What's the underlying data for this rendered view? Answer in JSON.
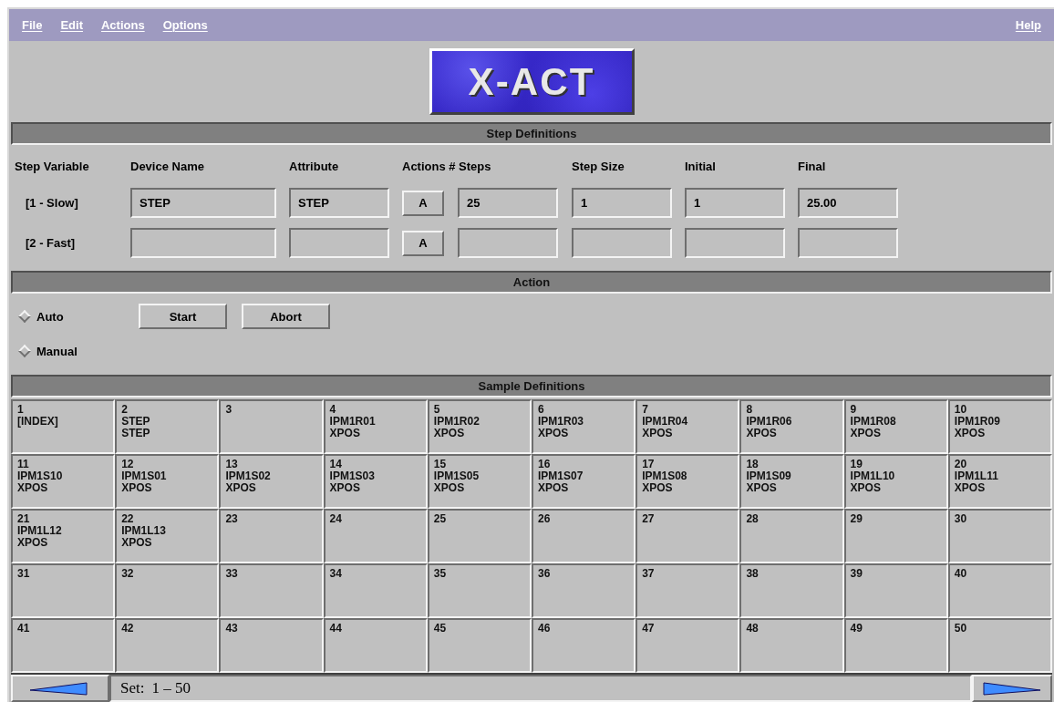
{
  "menu_bar": {
    "items": [
      "File",
      "Edit",
      "Actions",
      "Options"
    ],
    "help": "Help"
  },
  "logo": {
    "text": "X-ACT"
  },
  "step_definitions": {
    "title": "Step Definitions",
    "columns": [
      "Step Variable",
      "Device Name",
      "Attribute",
      "Actions # Steps",
      "Step Size",
      "Initial",
      "Final"
    ],
    "rows": [
      {
        "label": "[1 - Slow]",
        "device": "STEP",
        "attribute": "STEP",
        "action": "A",
        "steps": "25",
        "step_size": "1",
        "initial": "1",
        "final": "25.00"
      },
      {
        "label": "[2 - Fast]",
        "action": "A"
      }
    ]
  },
  "action": {
    "title": "Action",
    "modes": [
      {
        "label": "Auto",
        "selected": false
      },
      {
        "label": "Manual",
        "selected": false
      }
    ],
    "buttons": [
      "Start",
      "Abort"
    ]
  },
  "sample_definitions": {
    "title": "Sample Definitions",
    "cells": [
      {
        "number": "1",
        "lines": [
          "[INDEX]"
        ]
      },
      {
        "number": "2",
        "lines": [
          "STEP",
          "STEP"
        ]
      },
      {
        "number": "3"
      },
      {
        "number": "4",
        "lines": [
          "IPM1R01",
          "XPOS"
        ]
      },
      {
        "number": "5",
        "lines": [
          "IPM1R02",
          "XPOS"
        ]
      },
      {
        "number": "6",
        "lines": [
          "IPM1R03",
          "XPOS"
        ]
      },
      {
        "number": "7",
        "lines": [
          "IPM1R04",
          "XPOS"
        ]
      },
      {
        "number": "8",
        "lines": [
          "IPM1R06",
          "XPOS"
        ]
      },
      {
        "number": "9",
        "lines": [
          "IPM1R08",
          "XPOS"
        ]
      },
      {
        "number": "10",
        "lines": [
          "IPM1R09",
          "XPOS"
        ]
      },
      {
        "number": "11",
        "lines": [
          "IPM1S10",
          "XPOS"
        ]
      },
      {
        "number": "12",
        "lines": [
          "IPM1S01",
          "XPOS"
        ]
      },
      {
        "number": "13",
        "lines": [
          "IPM1S02",
          "XPOS"
        ]
      },
      {
        "number": "14",
        "lines": [
          "IPM1S03",
          "XPOS"
        ]
      },
      {
        "number": "15",
        "lines": [
          "IPM1S05",
          "XPOS"
        ]
      },
      {
        "number": "16",
        "lines": [
          "IPM1S07",
          "XPOS"
        ]
      },
      {
        "number": "17",
        "lines": [
          "IPM1S08",
          "XPOS"
        ]
      },
      {
        "number": "18",
        "lines": [
          "IPM1S09",
          "XPOS"
        ]
      },
      {
        "number": "19",
        "lines": [
          "IPM1L10",
          "XPOS"
        ]
      },
      {
        "number": "20",
        "lines": [
          "IPM1L11",
          "XPOS"
        ]
      },
      {
        "number": "21",
        "lines": [
          "IPM1L12",
          "XPOS"
        ]
      },
      {
        "number": "22",
        "lines": [
          "IPM1L13",
          "XPOS"
        ]
      },
      {
        "number": "23"
      },
      {
        "number": "24"
      },
      {
        "number": "25"
      },
      {
        "number": "26"
      },
      {
        "number": "27"
      },
      {
        "number": "28"
      },
      {
        "number": "29"
      },
      {
        "number": "30"
      },
      {
        "number": "31"
      },
      {
        "number": "32"
      },
      {
        "number": "33"
      },
      {
        "number": "34"
      },
      {
        "number": "35"
      },
      {
        "number": "36"
      },
      {
        "number": "37"
      },
      {
        "number": "38"
      },
      {
        "number": "39"
      },
      {
        "number": "40"
      },
      {
        "number": "41"
      },
      {
        "number": "42"
      },
      {
        "number": "43"
      },
      {
        "number": "44"
      },
      {
        "number": "45"
      },
      {
        "number": "46"
      },
      {
        "number": "47"
      },
      {
        "number": "48"
      },
      {
        "number": "49"
      },
      {
        "number": "50"
      }
    ]
  },
  "footer": {
    "set_label": "Set:",
    "range": "1 – 50"
  }
}
